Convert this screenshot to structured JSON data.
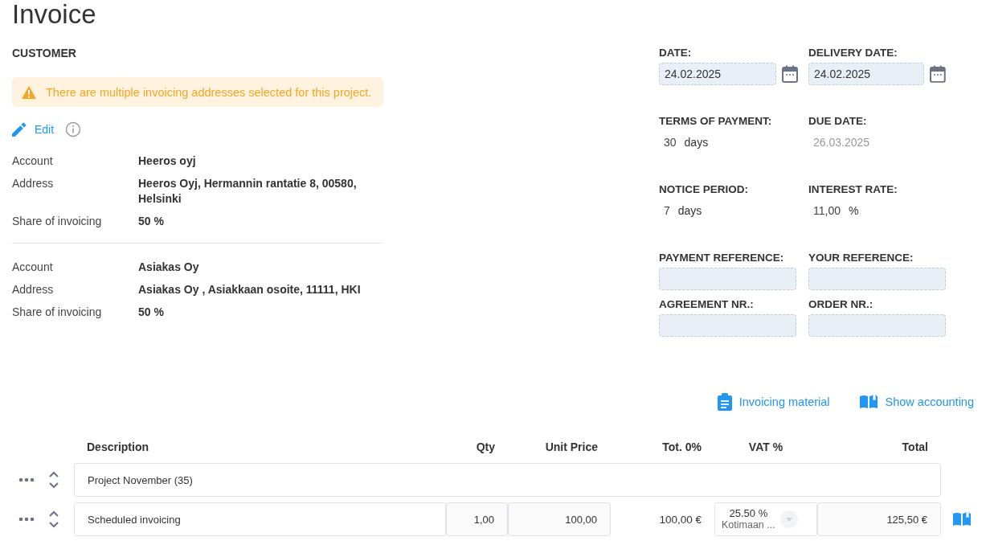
{
  "title": "Invoice",
  "customer": {
    "heading": "CUSTOMER",
    "warning": "There are multiple invoicing addresses selected for this project.",
    "edit_label": "Edit",
    "accounts": [
      {
        "fields": [
          {
            "label": "Account",
            "value": "Heeros oyj"
          },
          {
            "label": "Address",
            "value": "Heeros Oyj, Hermannin rantatie 8, 00580, Helsinki"
          },
          {
            "label": "Share of invoicing",
            "value": "50 %"
          }
        ]
      },
      {
        "fields": [
          {
            "label": "Account",
            "value": "Asiakas Oy"
          },
          {
            "label": "Address",
            "value": "Asiakas Oy , Asiakkaan osoite, 11111, HKI"
          },
          {
            "label": "Share of invoicing",
            "value": "50 %"
          }
        ]
      }
    ]
  },
  "details": [
    {
      "kind": "date",
      "label": "DATE:",
      "value": "24.02.2025"
    },
    {
      "kind": "date",
      "label": "DELIVERY DATE:",
      "value": "24.02.2025"
    },
    {
      "kind": "number",
      "label": "TERMS OF PAYMENT:",
      "value": "30",
      "unit": "days"
    },
    {
      "kind": "text",
      "label": "DUE DATE:",
      "value": "26.03.2025",
      "disabled": true
    },
    {
      "kind": "number",
      "label": "NOTICE PERIOD:",
      "value": "7",
      "unit": "days"
    },
    {
      "kind": "number",
      "label": "INTEREST RATE:",
      "value": "11,00",
      "unit": "%"
    },
    {
      "kind": "input",
      "label": "PAYMENT REFERENCE:"
    },
    {
      "kind": "input",
      "label": "YOUR REFERENCE:"
    },
    {
      "kind": "input",
      "label": "AGREEMENT NR.:"
    },
    {
      "kind": "input",
      "label": "ORDER NR.:"
    }
  ],
  "actions": [
    {
      "kind": "material",
      "label": "Invoicing material"
    },
    {
      "kind": "accounting",
      "label": "Show accounting"
    }
  ],
  "table": {
    "columns": [
      "Description",
      "Qty",
      "Unit Price",
      "Tot. 0%",
      "VAT %",
      "Total"
    ],
    "rows": [
      {
        "kind": "group",
        "description": "Project November (35)"
      },
      {
        "kind": "item",
        "description": "Scheduled invoicing",
        "qty": "1,00",
        "unit_price": "100,00",
        "total_excl": "100,00 €",
        "vat_rate": "25.50 %",
        "vat_name": "Kotimaan ...",
        "total": "125,50 €"
      }
    ]
  }
}
